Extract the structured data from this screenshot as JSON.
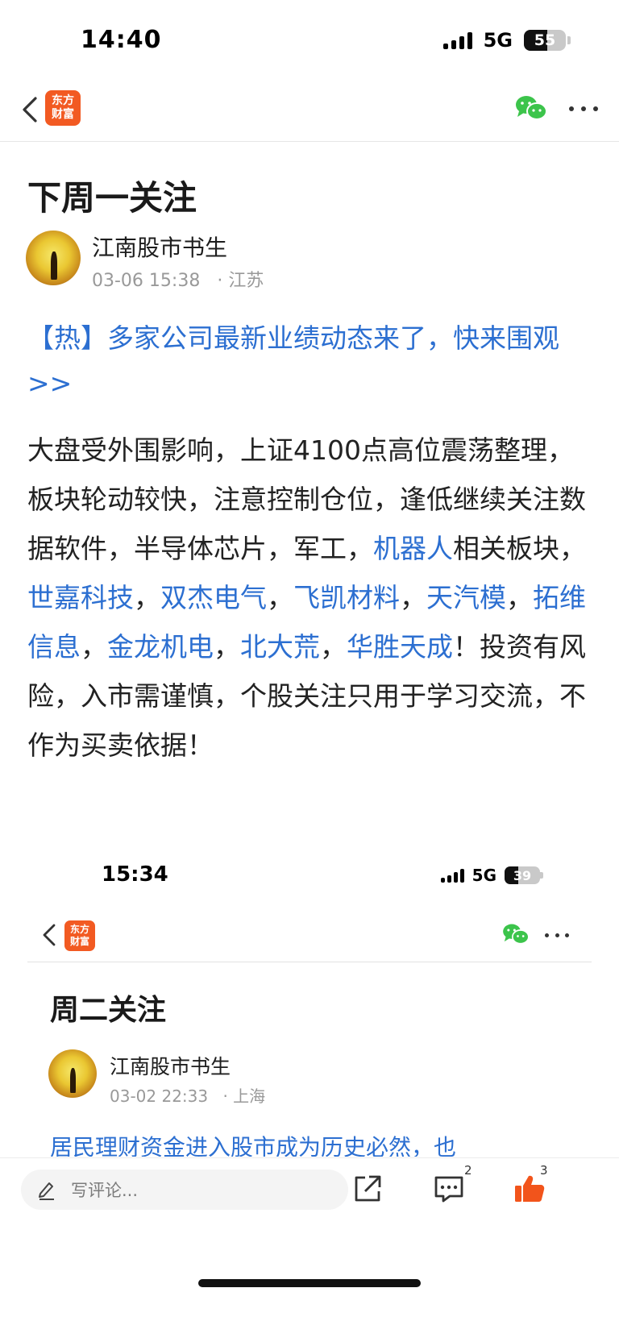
{
  "status_bar": {
    "time": "14:40",
    "network": "5G",
    "battery": "55",
    "battery_level": 0.55
  },
  "nav": {
    "logo_line1": "东方",
    "logo_line2": "财富"
  },
  "article": {
    "title": "下周一关注",
    "author": "江南股市书生",
    "time": "03-06 15:38",
    "location": "· 江苏",
    "hot_link": "【热】多家公司最新业绩动态来了，快来围观>>",
    "body_segments": [
      {
        "text": "大盘受外围影响，上证4100点高位震荡整理，板块轮动较快，注意控制仓位，逢低继续关注数据软件，半导体芯片，军工，",
        "link": false
      },
      {
        "text": "机器人",
        "link": true
      },
      {
        "text": "相关板块，",
        "link": false
      },
      {
        "text": "世嘉科技",
        "link": true
      },
      {
        "text": "，",
        "link": false
      },
      {
        "text": "双杰电气",
        "link": true
      },
      {
        "text": "，",
        "link": false
      },
      {
        "text": "飞凯材料",
        "link": true
      },
      {
        "text": "，",
        "link": false
      },
      {
        "text": "天汽模",
        "link": true
      },
      {
        "text": "，",
        "link": false
      },
      {
        "text": "拓维信息",
        "link": true
      },
      {
        "text": "，",
        "link": false
      },
      {
        "text": "金龙机电",
        "link": true
      },
      {
        "text": "，",
        "link": false
      },
      {
        "text": "北大荒",
        "link": true
      },
      {
        "text": "，",
        "link": false
      },
      {
        "text": "华胜天成",
        "link": true
      },
      {
        "text": "！投资有风险，入市需谨慎，个股关注只用于学习交流，不作为买卖依据！",
        "link": false
      }
    ]
  },
  "embedded_screenshot": {
    "time": "15:34",
    "network": "5G",
    "battery": "39",
    "battery_level": 0.39,
    "logo_line1": "东方",
    "logo_line2": "财富",
    "title": "周二关注",
    "author": "江南股市书生",
    "time_posted": "03-02 22:33",
    "location": "· 上海",
    "link_preview": "居民理财资金进入股市成为历史必然，也"
  },
  "bottom_bar": {
    "comment_placeholder": "写评论...",
    "comment_count": "2",
    "like_count": "3"
  },
  "colors": {
    "link": "#2c6fd1",
    "brand": "#f25a22",
    "like": "#f2541b",
    "wechat": "#3cc44b"
  }
}
